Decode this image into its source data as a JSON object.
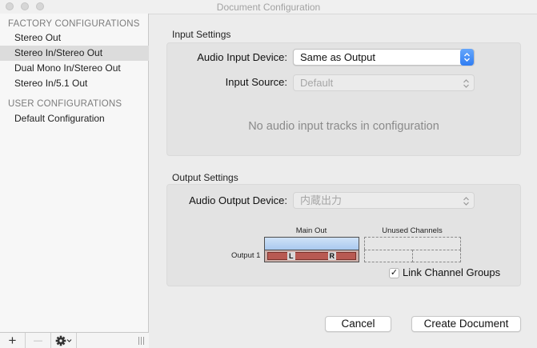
{
  "window": {
    "title": "Document Configuration"
  },
  "sidebar": {
    "factory_header": "FACTORY CONFIGURATIONS",
    "factory_items": [
      {
        "label": "Stereo Out"
      },
      {
        "label": "Stereo In/Stereo Out",
        "selected": true
      },
      {
        "label": "Dual Mono In/Stereo Out"
      },
      {
        "label": "Stereo In/5.1 Out"
      }
    ],
    "user_header": "USER CONFIGURATIONS",
    "user_items": [
      {
        "label": "Default Configuration"
      }
    ],
    "toolbar": {
      "add": "+",
      "remove": "—"
    }
  },
  "input_settings": {
    "section_title": "Input Settings",
    "device_label": "Audio Input Device:",
    "device_value": "Same as Output",
    "source_label": "Input Source:",
    "source_value": "Default",
    "empty_message": "No audio input tracks in configuration"
  },
  "output_settings": {
    "section_title": "Output Settings",
    "device_label": "Audio Output Device:",
    "device_value": "内蔵出力",
    "matrix": {
      "main_out_header": "Main Out",
      "unused_header": "Unused Channels",
      "row_label": "Output 1",
      "left_channel": "L",
      "right_channel": "R"
    },
    "link_groups_label": "Link Channel Groups",
    "link_groups_checked": true
  },
  "buttons": {
    "cancel": "Cancel",
    "create": "Create Document"
  },
  "colors": {
    "accent": "#2f7df3",
    "channel_red": "#b85a52",
    "channel_blue": "#b9d4f2"
  }
}
